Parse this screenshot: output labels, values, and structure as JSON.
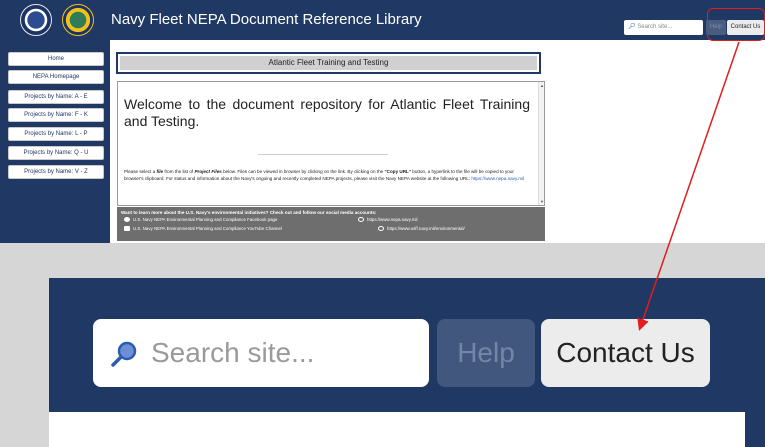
{
  "header": {
    "title": "Navy Fleet NEPA Document Reference Library",
    "search_placeholder": "Search site...",
    "help_label": "Help",
    "contact_label": "Contact Us"
  },
  "sidebar": {
    "items": [
      {
        "label": "Home"
      },
      {
        "label": "NEPA Homepage"
      },
      {
        "label": "Projects by Name: A - E"
      },
      {
        "label": "Projects by Name: F - K"
      },
      {
        "label": "Projects by Name: L - P"
      },
      {
        "label": "Projects by Name: Q - U"
      },
      {
        "label": "Projects by Name: V - Z"
      }
    ]
  },
  "main": {
    "section_title": "Atlantic Fleet Training and Testing",
    "welcome": "Welcome to the document repository for Atlantic Fleet Training and Testing.",
    "intro": {
      "p1": "Please select a ",
      "file": "file",
      "p2": " from the list of ",
      "project_files": "Project Files",
      "p3": " below. Files can be viewed in browser by clicking on the link. By clicking on the ",
      "copy_url": "\"Copy URL\"",
      "p4": " button, a hyperlink to the file will be copied to your browser's clipboard. For status and information about the Navy's ongoing and recently completed NEPA projects, please visit the Navy NEPA website at the following URL: ",
      "link": "https://www.nepa.navy.mil"
    }
  },
  "social": {
    "title": "Want to learn more about the U.S. Navy's environmental initiatives? Check out and follow our social media accounts:",
    "links": [
      {
        "label": "U.S. Navy NEPA Environmental Planning and Compliance Facebook page",
        "icon": "facebook-icon"
      },
      {
        "label": "U.S. Navy NEPA Environmental Planning and Compliance YouTube Channel",
        "icon": "youtube-icon"
      },
      {
        "label": "https://www.nepa.navy.mil",
        "icon": "globe-icon"
      },
      {
        "label": "https://www.usff.navy.mil/environmental/",
        "icon": "globe-icon"
      }
    ]
  },
  "zoom": {
    "search_placeholder": "Search site...",
    "help_label": "Help",
    "contact_label": "Contact Us"
  },
  "colors": {
    "navy": "#1f3864",
    "callout": "#e21d1d"
  }
}
